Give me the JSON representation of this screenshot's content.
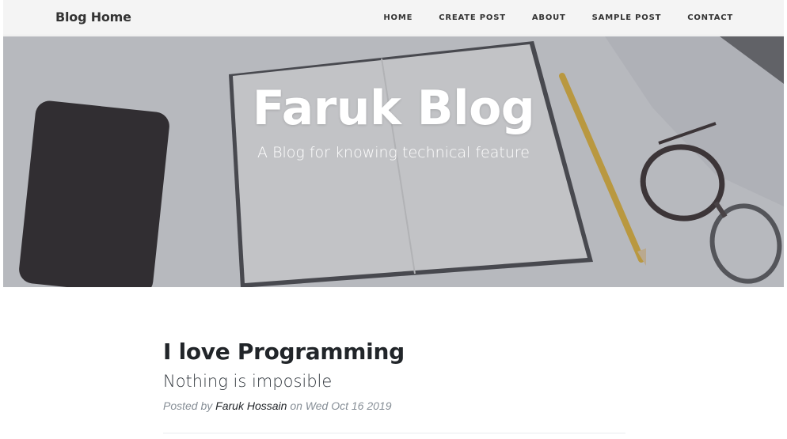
{
  "navbar": {
    "brand": "Blog Home",
    "links": [
      "HOME",
      "CREATE POST",
      "ABOUT",
      "SAMPLE POST",
      "CONTACT"
    ]
  },
  "hero": {
    "title": "Faruk Blog",
    "subtitle": "A Blog for knowing technical feature"
  },
  "post": {
    "title": "I love Programming",
    "subtitle": "Nothing is imposible",
    "meta_prefix": "Posted by",
    "author": "Faruk Hossain",
    "meta_on": "on",
    "date": "Wed Oct 16 2019"
  }
}
